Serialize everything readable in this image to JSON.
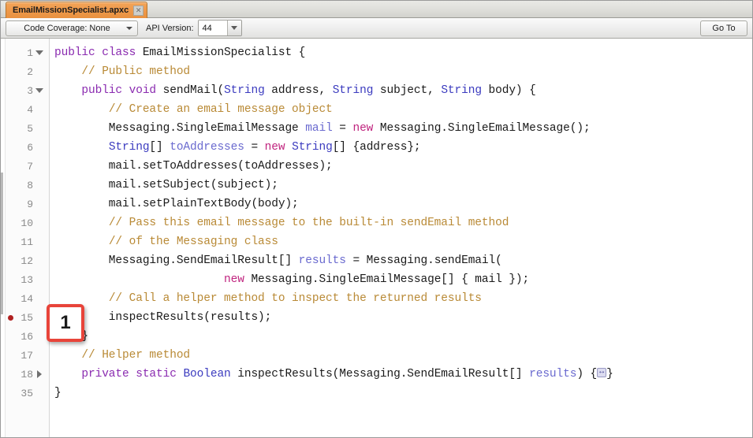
{
  "window": {
    "title": "EmailMissionSpecialist.apxc"
  },
  "tabbar": {
    "tabs": [
      {
        "label": "EmailMissionSpecialist.apxc",
        "close_glyph": "✕",
        "active": true
      }
    ]
  },
  "toolbar": {
    "code_coverage_label": "Code Coverage: None",
    "api_version_label": "API Version:",
    "api_version_value": "44",
    "goto_label": "Go To"
  },
  "annotation": {
    "number": "1",
    "color": "#e8443a",
    "attached_line": 15
  },
  "editor": {
    "breakpoint_line": 15,
    "lines": [
      {
        "num": "1",
        "fold": "down",
        "breakpoint": false,
        "tokens": [
          {
            "t": "public ",
            "c": "kw"
          },
          {
            "t": "class ",
            "c": "kw"
          },
          {
            "t": "EmailMissionSpecialist {",
            "c": "plain"
          }
        ]
      },
      {
        "num": "2",
        "fold": "",
        "breakpoint": false,
        "tokens": [
          {
            "t": "    ",
            "c": "plain"
          },
          {
            "t": "// Public method",
            "c": "cmt"
          }
        ]
      },
      {
        "num": "3",
        "fold": "down",
        "breakpoint": false,
        "tokens": [
          {
            "t": "    ",
            "c": "plain"
          },
          {
            "t": "public ",
            "c": "kw"
          },
          {
            "t": "void ",
            "c": "kw"
          },
          {
            "t": "sendMail(",
            "c": "plain"
          },
          {
            "t": "String",
            "c": "type"
          },
          {
            "t": " address, ",
            "c": "plain"
          },
          {
            "t": "String",
            "c": "type"
          },
          {
            "t": " subject, ",
            "c": "plain"
          },
          {
            "t": "String",
            "c": "type"
          },
          {
            "t": " body) {",
            "c": "plain"
          }
        ]
      },
      {
        "num": "4",
        "fold": "",
        "breakpoint": false,
        "tokens": [
          {
            "t": "        ",
            "c": "plain"
          },
          {
            "t": "// Create an email message object",
            "c": "cmt"
          }
        ]
      },
      {
        "num": "5",
        "fold": "",
        "breakpoint": false,
        "tokens": [
          {
            "t": "        Messaging.SingleEmailMessage ",
            "c": "plain"
          },
          {
            "t": "mail",
            "c": "var"
          },
          {
            "t": " = ",
            "c": "plain"
          },
          {
            "t": "new",
            "c": "new"
          },
          {
            "t": " Messaging.SingleEmailMessage();",
            "c": "plain"
          }
        ]
      },
      {
        "num": "6",
        "fold": "",
        "breakpoint": false,
        "tokens": [
          {
            "t": "        ",
            "c": "plain"
          },
          {
            "t": "String",
            "c": "type"
          },
          {
            "t": "[] ",
            "c": "plain"
          },
          {
            "t": "toAddresses",
            "c": "var"
          },
          {
            "t": " = ",
            "c": "plain"
          },
          {
            "t": "new",
            "c": "new"
          },
          {
            "t": " ",
            "c": "plain"
          },
          {
            "t": "String",
            "c": "type"
          },
          {
            "t": "[] {address};",
            "c": "plain"
          }
        ]
      },
      {
        "num": "7",
        "fold": "",
        "breakpoint": false,
        "tokens": [
          {
            "t": "        mail.setToAddresses(toAddresses);",
            "c": "plain"
          }
        ]
      },
      {
        "num": "8",
        "fold": "",
        "breakpoint": false,
        "tokens": [
          {
            "t": "        mail.setSubject(subject);",
            "c": "plain"
          }
        ]
      },
      {
        "num": "9",
        "fold": "",
        "breakpoint": false,
        "tokens": [
          {
            "t": "        mail.setPlainTextBody(body);",
            "c": "plain"
          }
        ]
      },
      {
        "num": "10",
        "fold": "",
        "breakpoint": false,
        "tokens": [
          {
            "t": "        ",
            "c": "plain"
          },
          {
            "t": "// Pass this email message to the built-in sendEmail method",
            "c": "cmt"
          }
        ]
      },
      {
        "num": "11",
        "fold": "",
        "breakpoint": false,
        "tokens": [
          {
            "t": "        ",
            "c": "plain"
          },
          {
            "t": "// of the Messaging class",
            "c": "cmt"
          }
        ]
      },
      {
        "num": "12",
        "fold": "",
        "breakpoint": false,
        "tokens": [
          {
            "t": "        Messaging.SendEmailResult[] ",
            "c": "plain"
          },
          {
            "t": "results",
            "c": "var"
          },
          {
            "t": " = Messaging.sendEmail(",
            "c": "plain"
          }
        ]
      },
      {
        "num": "13",
        "fold": "",
        "breakpoint": false,
        "tokens": [
          {
            "t": "                         ",
            "c": "plain"
          },
          {
            "t": "new",
            "c": "new"
          },
          {
            "t": " Messaging.SingleEmailMessage[] { mail });",
            "c": "plain"
          }
        ]
      },
      {
        "num": "14",
        "fold": "",
        "breakpoint": false,
        "tokens": [
          {
            "t": "        ",
            "c": "plain"
          },
          {
            "t": "// Call a helper method to inspect the returned results",
            "c": "cmt"
          }
        ]
      },
      {
        "num": "15",
        "fold": "",
        "breakpoint": true,
        "tokens": [
          {
            "t": "        inspectResults(results);",
            "c": "plain"
          }
        ]
      },
      {
        "num": "16",
        "fold": "",
        "breakpoint": false,
        "tokens": [
          {
            "t": "    }",
            "c": "plain"
          }
        ]
      },
      {
        "num": "17",
        "fold": "",
        "breakpoint": false,
        "tokens": [
          {
            "t": "    ",
            "c": "plain"
          },
          {
            "t": "// Helper method",
            "c": "cmt"
          }
        ]
      },
      {
        "num": "18",
        "fold": "right",
        "breakpoint": false,
        "tokens": [
          {
            "t": "    ",
            "c": "plain"
          },
          {
            "t": "private ",
            "c": "kw"
          },
          {
            "t": "static ",
            "c": "kw"
          },
          {
            "t": "Boolean",
            "c": "type"
          },
          {
            "t": " inspectResults(Messaging.SendEmailResult[] ",
            "c": "plain"
          },
          {
            "t": "results",
            "c": "var"
          },
          {
            "t": ") {",
            "c": "plain"
          },
          {
            "t": "↔",
            "c": "foldmark"
          },
          {
            "t": "}",
            "c": "plain"
          }
        ]
      },
      {
        "num": "35",
        "fold": "",
        "breakpoint": false,
        "tokens": [
          {
            "t": "}",
            "c": "plain"
          }
        ]
      }
    ]
  }
}
